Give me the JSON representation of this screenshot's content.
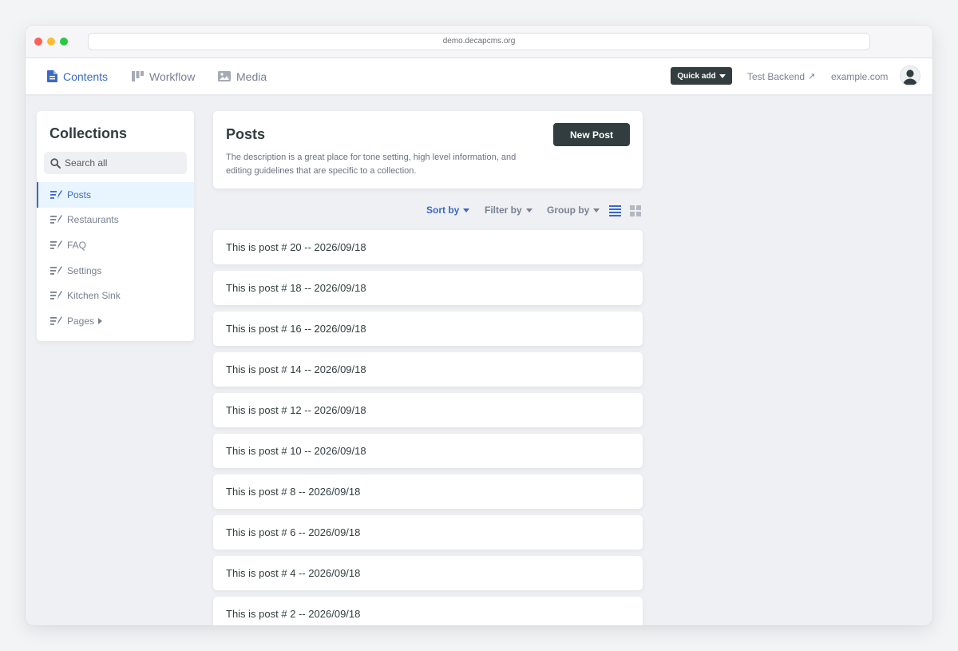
{
  "browser": {
    "url": "demo.decapcms.org"
  },
  "nav": {
    "tabs": [
      {
        "label": "Contents",
        "icon": "document-icon",
        "active": true
      },
      {
        "label": "Workflow",
        "icon": "workflow-icon",
        "active": false
      },
      {
        "label": "Media",
        "icon": "media-icon",
        "active": false
      }
    ],
    "quick_add": "Quick add",
    "test_backend": "Test Backend",
    "external_arrow": "↗",
    "site": "example.com"
  },
  "sidebar": {
    "title": "Collections",
    "search_placeholder": "Search all",
    "items": [
      {
        "label": "Posts",
        "active": true
      },
      {
        "label": "Restaurants",
        "active": false
      },
      {
        "label": "FAQ",
        "active": false
      },
      {
        "label": "Settings",
        "active": false
      },
      {
        "label": "Kitchen Sink",
        "active": false
      },
      {
        "label": "Pages",
        "active": false,
        "expandable": true
      }
    ]
  },
  "collection": {
    "title": "Posts",
    "description": "The description is a great place for tone setting, high level information, and editing guidelines that are specific to a collection.",
    "new_button": "New Post"
  },
  "controls": {
    "sort": "Sort by",
    "filter": "Filter by",
    "group": "Group by",
    "view_mode": "list"
  },
  "entries": [
    "This is post # 20 -- 2026/09/18",
    "This is post # 18 -- 2026/09/18",
    "This is post # 16 -- 2026/09/18",
    "This is post # 14 -- 2026/09/18",
    "This is post # 12 -- 2026/09/18",
    "This is post # 10 -- 2026/09/18",
    "This is post # 8 -- 2026/09/18",
    "This is post # 6 -- 2026/09/18",
    "This is post # 4 -- 2026/09/18",
    "This is post # 2 -- 2026/09/18"
  ],
  "colors": {
    "accent": "#3a69c7",
    "dark": "#313d3e",
    "muted": "#798291",
    "background": "#eff0f4"
  }
}
